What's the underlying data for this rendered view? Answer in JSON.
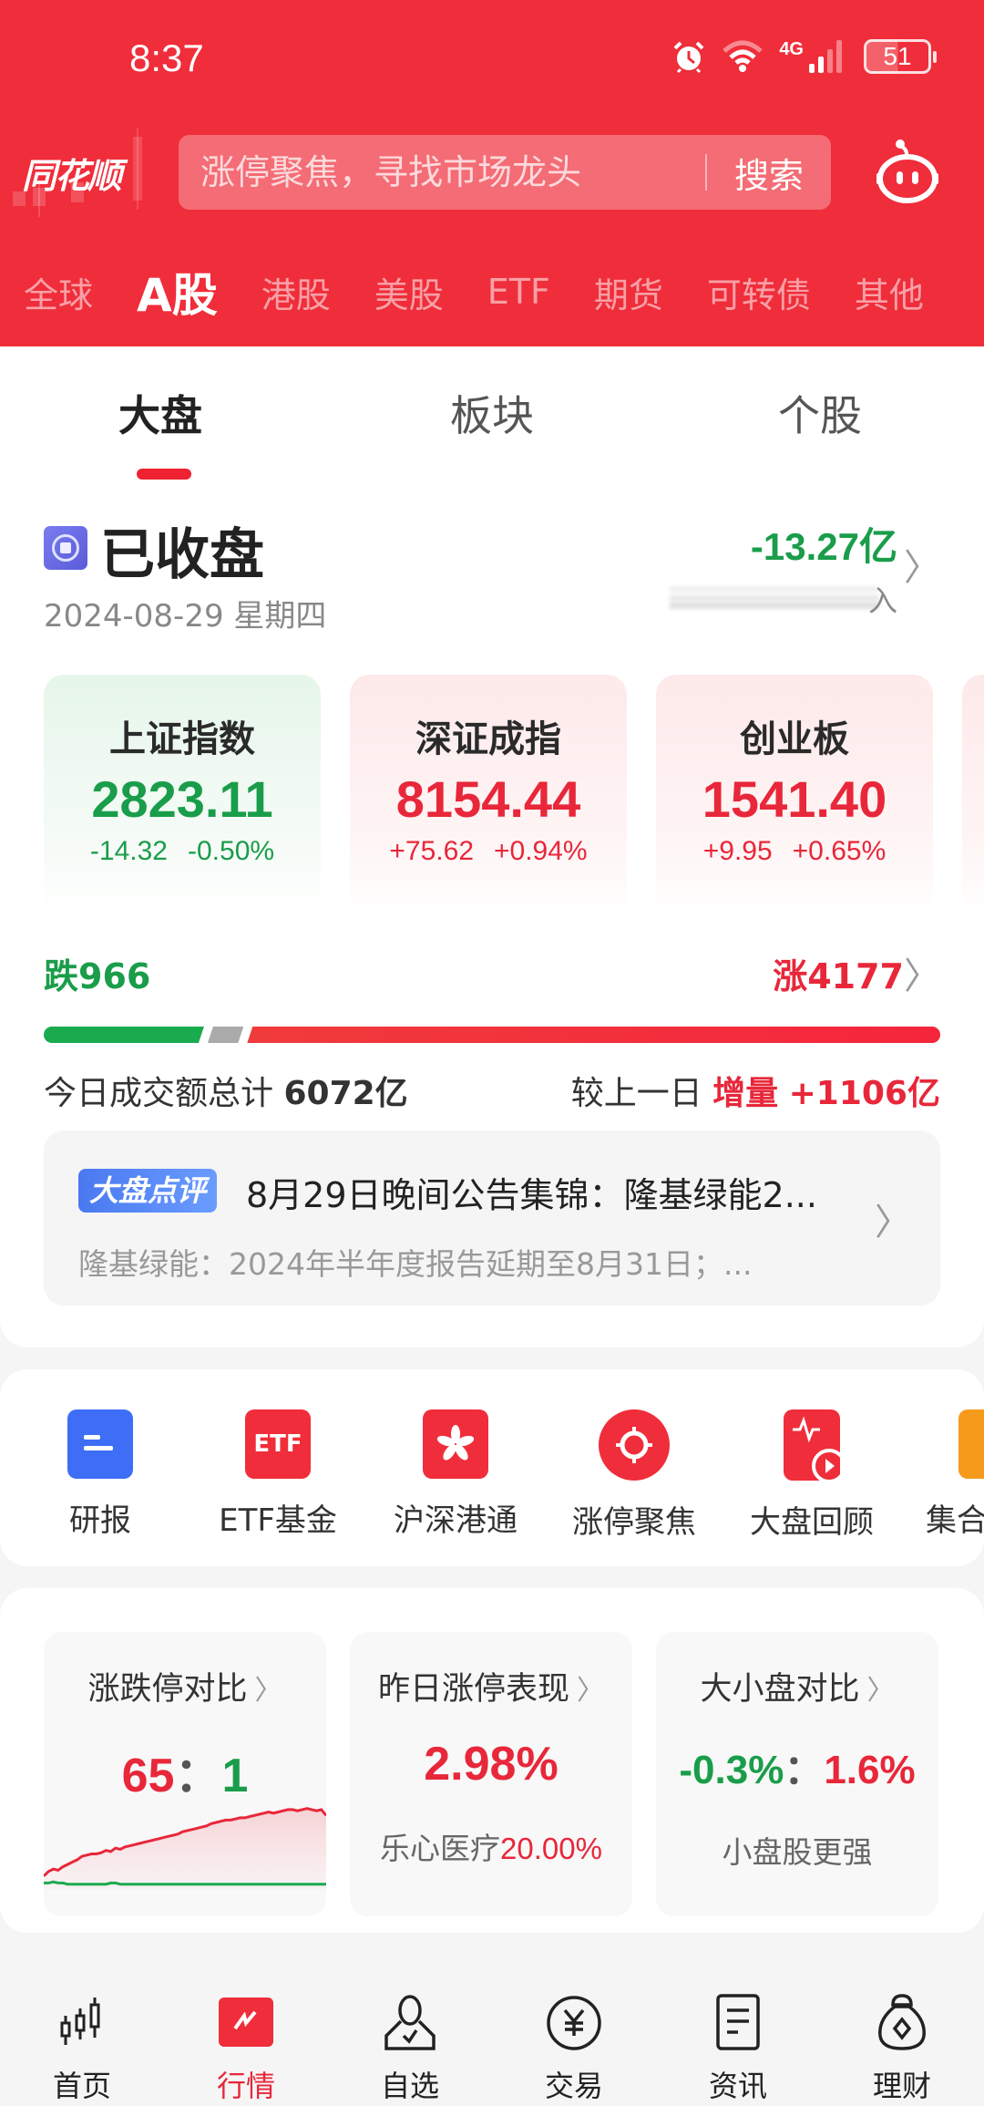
{
  "status_bar": {
    "time": "8:37",
    "network": "4G",
    "battery": "51",
    "icons": [
      "alarm-icon",
      "wifi-icon",
      "signal-icon",
      "battery-icon"
    ]
  },
  "header": {
    "logo": "同花顺",
    "search_placeholder": "涨停聚焦，寻找市场龙头",
    "search_button": "搜索",
    "assistant_icon": "robot-icon"
  },
  "market_tabs": [
    {
      "label": "全球",
      "active": false
    },
    {
      "label": "A股",
      "active": true
    },
    {
      "label": "港股",
      "active": false
    },
    {
      "label": "美股",
      "active": false
    },
    {
      "label": "ETF",
      "active": false
    },
    {
      "label": "期货",
      "active": false
    },
    {
      "label": "可转债",
      "active": false
    },
    {
      "label": "其他",
      "active": false
    }
  ],
  "sub_tabs": [
    {
      "label": "大盘",
      "active": true
    },
    {
      "label": "板块",
      "active": false
    },
    {
      "label": "个股",
      "active": false
    }
  ],
  "market_status": {
    "title": "已收盘",
    "date": "2024-08-29 星期四",
    "flow_value": "-13.27亿",
    "flow_label_visible": "入"
  },
  "indices": [
    {
      "name": "上证指数",
      "value": "2823.11",
      "change": "-14.32",
      "pct": "-0.50%",
      "trend": "down"
    },
    {
      "name": "深证成指",
      "value": "8154.44",
      "change": "+75.62",
      "pct": "+0.94%",
      "trend": "up"
    },
    {
      "name": "创业板",
      "value": "1541.40",
      "change": "+9.95",
      "pct": "+0.65%",
      "trend": "up"
    }
  ],
  "breadth": {
    "fall_label": "跌966",
    "rise_label": "涨4177",
    "fall": 966,
    "flat_share": 0.04,
    "rise": 4177,
    "colors": {
      "fall": "#1aab4e",
      "flat": "#aaaaaa",
      "rise": "#f03b3b"
    }
  },
  "turnover": {
    "label": "今日成交额总计",
    "value": "6072亿",
    "compare_label": "较上一日",
    "compare_kind": "增量",
    "compare_value": "+1106亿"
  },
  "news": {
    "badge": "大盘点评",
    "title": "8月29日晚间公告集锦：隆基绿能2...",
    "summary": "隆基绿能：2024年半年度报告延期至8月31日；..."
  },
  "quick_entries": [
    {
      "label": "研报",
      "icon": "report-icon",
      "color": "#3d6ef5"
    },
    {
      "label": "ETF基金",
      "icon": "etf-icon",
      "color": "#f02d3a"
    },
    {
      "label": "沪深港通",
      "icon": "bauhinia-icon",
      "color": "#f02d3a"
    },
    {
      "label": "涨停聚焦",
      "icon": "target-icon",
      "color": "#f02d3a"
    },
    {
      "label": "大盘回顾",
      "icon": "replay-icon",
      "color": "#f02d3a"
    },
    {
      "label": "集合",
      "icon": "auction-icon",
      "color": "#f59a1b"
    }
  ],
  "stats": [
    {
      "title": "涨跌停对比",
      "left": "65",
      "sep": "：",
      "right": "1"
    },
    {
      "title": "昨日涨停表现",
      "value": "2.98%",
      "sub_name": "乐心医疗",
      "sub_value": "20.00%"
    },
    {
      "title": "大小盘对比",
      "left": "-0.3%",
      "sep": "：",
      "right": "1.6%",
      "sub": "小盘股更强"
    }
  ],
  "limit_chart": {
    "up_limit_series": [
      8,
      12,
      14,
      13,
      16,
      18,
      20,
      22,
      25,
      26,
      27,
      27,
      28,
      30,
      29,
      32,
      31,
      33,
      34,
      35,
      36,
      37,
      38,
      39,
      40,
      41,
      42,
      43,
      44,
      46,
      47,
      48,
      49,
      50,
      51,
      53,
      54,
      55,
      56,
      56,
      57,
      58,
      58,
      59,
      60,
      61,
      62,
      63,
      62,
      63,
      64,
      65,
      65,
      64,
      65,
      66,
      65,
      64,
      65,
      60
    ],
    "down_limit_series": [
      2,
      2,
      3,
      2,
      2,
      1,
      1,
      1,
      1,
      1,
      1,
      1,
      1,
      1,
      2,
      2,
      1,
      1,
      1,
      1,
      1,
      1,
      1,
      1,
      1,
      1,
      1,
      1,
      1,
      1,
      1,
      1,
      1,
      1,
      1,
      1,
      1,
      1,
      1,
      1,
      1,
      1,
      1,
      1,
      1,
      1,
      1,
      1,
      1,
      1,
      1,
      1,
      1,
      1,
      1,
      1,
      1,
      1,
      1,
      1
    ],
    "y_max": 72
  },
  "bottom_nav": [
    {
      "label": "首页",
      "icon": "candlestick-icon",
      "active": false
    },
    {
      "label": "行情",
      "icon": "market-icon",
      "active": true
    },
    {
      "label": "自选",
      "icon": "watchlist-icon",
      "active": false
    },
    {
      "label": "交易",
      "icon": "yen-icon",
      "active": false
    },
    {
      "label": "资讯",
      "icon": "news-icon",
      "active": false
    },
    {
      "label": "理财",
      "icon": "money-bag-icon",
      "active": false
    }
  ]
}
